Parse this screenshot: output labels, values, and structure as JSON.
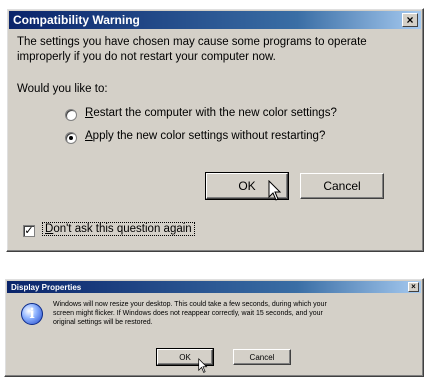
{
  "compat": {
    "title": "Compatibility Warning",
    "close_glyph": "×",
    "message_line1": "The settings you have chosen may cause some programs to operate",
    "message_line2": "improperly if you do not restart your computer now.",
    "prompt": "Would you like to:",
    "options": [
      {
        "accel": "R",
        "rest": "estart the computer with the new color settings?",
        "selected": false
      },
      {
        "accel": "A",
        "rest": "pply the new color settings without restarting?",
        "selected": true
      }
    ],
    "ok_label": "OK",
    "cancel_label": "Cancel",
    "dont_ask": {
      "accel": "D",
      "rest": "on't ask this question again",
      "checked": true
    },
    "check_glyph": "✓"
  },
  "display": {
    "title": "Display Properties",
    "close_glyph": "×",
    "icon_glyph": "i",
    "message_line1": "Windows will now resize your desktop. This could take a few seconds, during which your",
    "message_line2": "screen might flicker. If Windows does not reappear correctly, wait 15 seconds, and your",
    "message_line3": "original settings will be restored.",
    "ok_label": "OK",
    "cancel_label": "Cancel"
  },
  "colors": {
    "window_bg": "#d4d0c8",
    "title_gradient_start": "#0a246a",
    "title_gradient_end": "#a6caf0"
  }
}
